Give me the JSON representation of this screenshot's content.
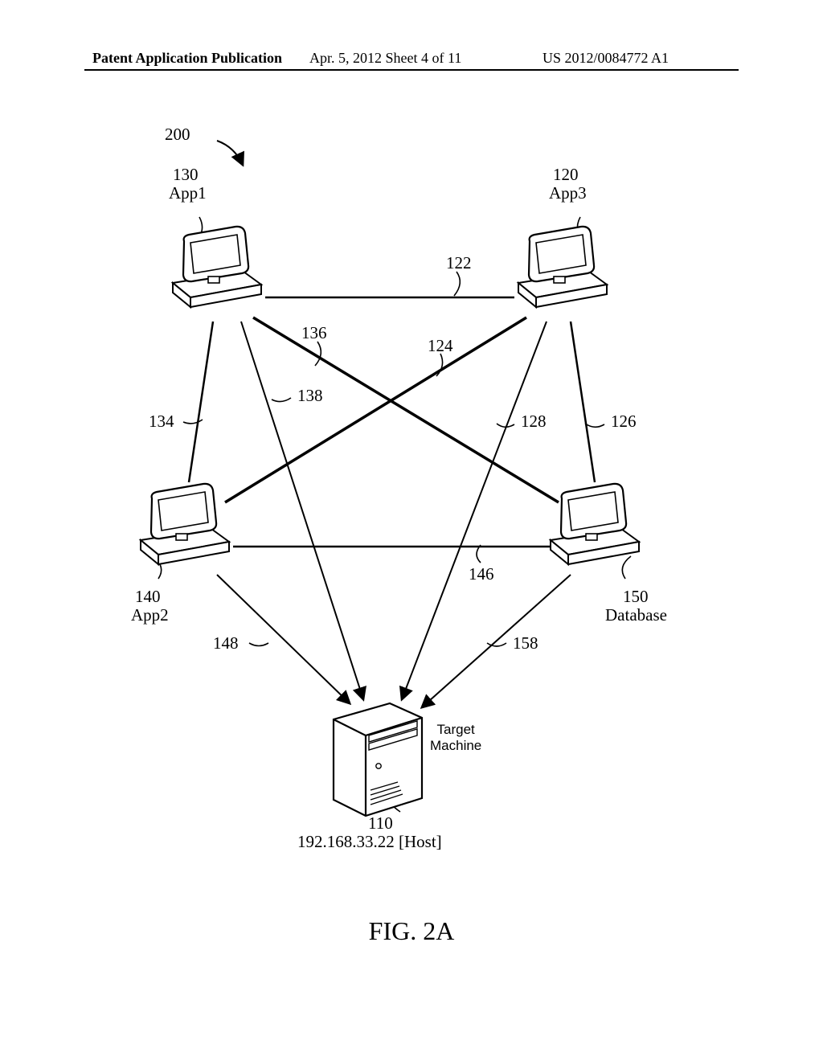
{
  "header": {
    "left": "Patent Application Publication",
    "center": "Apr. 5, 2012   Sheet 4 of 11",
    "right": "US 2012/0084772 A1"
  },
  "figure_caption": "FIG. 2A",
  "nodes": {
    "app1": {
      "ref": "130",
      "name": "App1"
    },
    "app3": {
      "ref": "120",
      "name": "App3"
    },
    "app2": {
      "ref": "140",
      "name": "App2"
    },
    "database": {
      "ref": "150",
      "name": "Database"
    },
    "target": {
      "ref": "110",
      "name": "Target\nMachine",
      "host": "192.168.33.22 [Host]"
    }
  },
  "edge_refs": {
    "e122": "122",
    "e124": "124",
    "e126": "126",
    "e128": "128",
    "e134": "134",
    "e136": "136",
    "e138": "138",
    "e146": "146",
    "e148": "148",
    "e158": "158",
    "system": "200"
  },
  "chart_data": {
    "type": "diagram",
    "title": "FIG. 2A — system 200 network/deployment topology",
    "nodes": [
      {
        "id": 130,
        "label": "App1",
        "kind": "workstation"
      },
      {
        "id": 120,
        "label": "App3",
        "kind": "workstation"
      },
      {
        "id": 140,
        "label": "App2",
        "kind": "workstation"
      },
      {
        "id": 150,
        "label": "Database",
        "kind": "workstation"
      },
      {
        "id": 110,
        "label": "Target Machine",
        "kind": "server",
        "host": "192.168.33.22"
      }
    ],
    "edges": [
      {
        "id": 122,
        "from": 130,
        "to": 120,
        "directed": false
      },
      {
        "id": 134,
        "from": 130,
        "to": 140,
        "directed": false
      },
      {
        "id": 136,
        "from": 130,
        "to": 150,
        "directed": false
      },
      {
        "id": 138,
        "from": 130,
        "to": 110,
        "directed": true
      },
      {
        "id": 124,
        "from": 120,
        "to": 140,
        "directed": false
      },
      {
        "id": 126,
        "from": 120,
        "to": 150,
        "directed": false
      },
      {
        "id": 128,
        "from": 120,
        "to": 110,
        "directed": true
      },
      {
        "id": 146,
        "from": 140,
        "to": 150,
        "directed": false
      },
      {
        "id": 148,
        "from": 140,
        "to": 110,
        "directed": true
      },
      {
        "id": 158,
        "from": 150,
        "to": 110,
        "directed": true
      }
    ],
    "system_ref": 200
  }
}
